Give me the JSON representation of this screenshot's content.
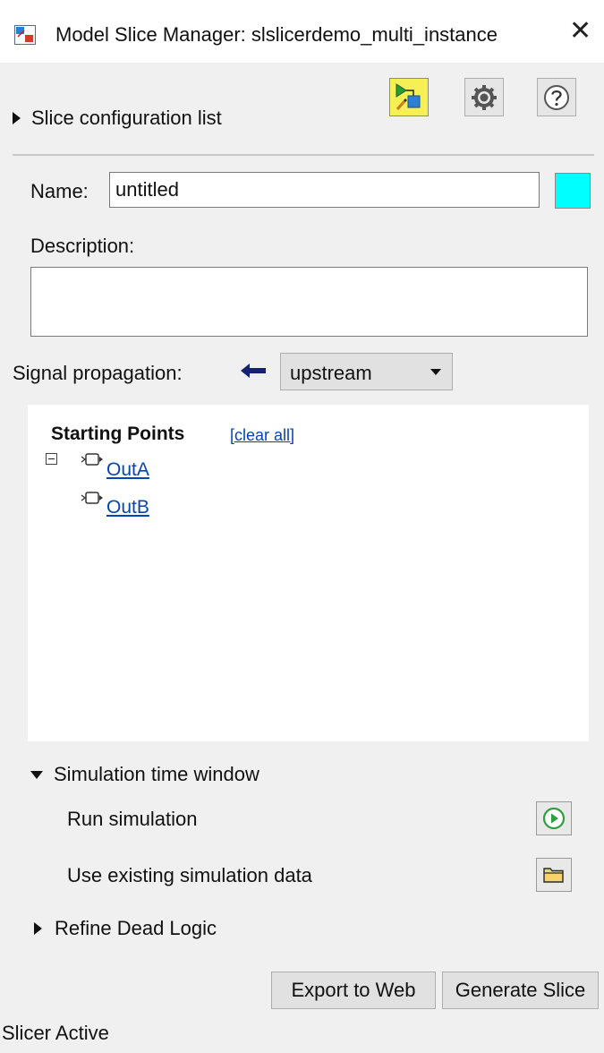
{
  "window": {
    "title": "Model Slice Manager: slslicerdemo_multi_instance",
    "close_glyph": "✕"
  },
  "toolbar": {
    "config_list_label": "Slice configuration list",
    "buttons": [
      {
        "icon": "highlight-slice-icon",
        "active": true
      },
      {
        "icon": "settings-gear-icon",
        "active": false
      },
      {
        "icon": "help-icon",
        "active": false
      }
    ]
  },
  "form": {
    "name_label": "Name:",
    "name_value": "untitled",
    "color": "#00ffff",
    "description_label": "Description:",
    "description_value": "",
    "propagation_label": "Signal propagation:",
    "propagation_arrow": "🡐",
    "propagation_value": "upstream"
  },
  "starting_points": {
    "title": "Starting Points",
    "clear_all": "[clear all]",
    "items": [
      "OutA",
      "OutB"
    ]
  },
  "simulation": {
    "section_label": "Simulation time window",
    "run_label": "Run simulation",
    "existing_label": "Use existing simulation data"
  },
  "dead_logic": {
    "section_label": "Refine Dead Logic"
  },
  "actions": {
    "export_label": "Export to Web",
    "generate_label": "Generate Slice"
  },
  "status": {
    "text": "Slicer Active"
  },
  "colors": {
    "accent_yellow": "#f7f055",
    "link_blue": "#0645ad",
    "arrow_navy": "#14207a",
    "run_green": "#2e9e3f"
  }
}
